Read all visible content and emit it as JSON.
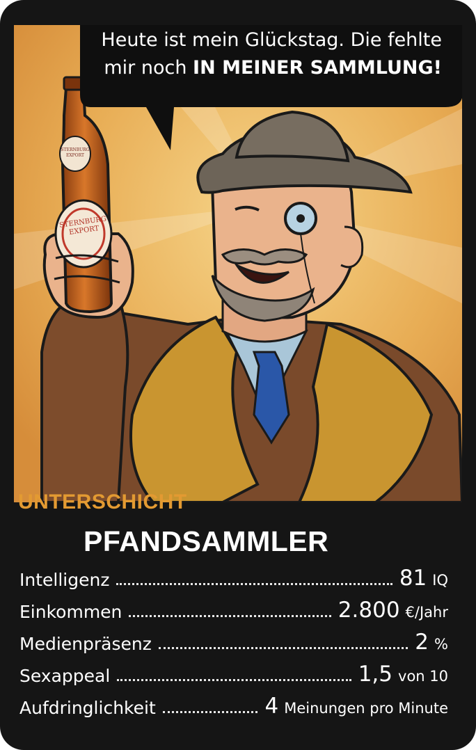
{
  "speech": {
    "line1": "Heute ist mein Glückstag. Die fehlte",
    "line2_prefix": "mir noch",
    "line2_emphasis": "IN MEINER SAMMLUNG!"
  },
  "bottle_label": {
    "neck": "STERNBURG EXPORT",
    "body": "STERNBURG EXPORT"
  },
  "card": {
    "category": "UNTERSCHICHT",
    "name": "PFANDSAMMLER"
  },
  "stats": [
    {
      "label": "Intelligenz",
      "value": "81",
      "unit": "IQ"
    },
    {
      "label": "Einkommen",
      "value": "2.800",
      "unit": "€/Jahr"
    },
    {
      "label": "Medienpräsenz",
      "value": "2",
      "unit": "%"
    },
    {
      "label": "Sexappeal",
      "value": "1,5",
      "unit": "von 10"
    },
    {
      "label": "Aufdringlichkeit",
      "value": "4",
      "unit": "Meinungen pro Minute"
    }
  ],
  "colors": {
    "card_background": "#151515",
    "category_text": "#e39a32",
    "art_background": "#e6a94e"
  }
}
